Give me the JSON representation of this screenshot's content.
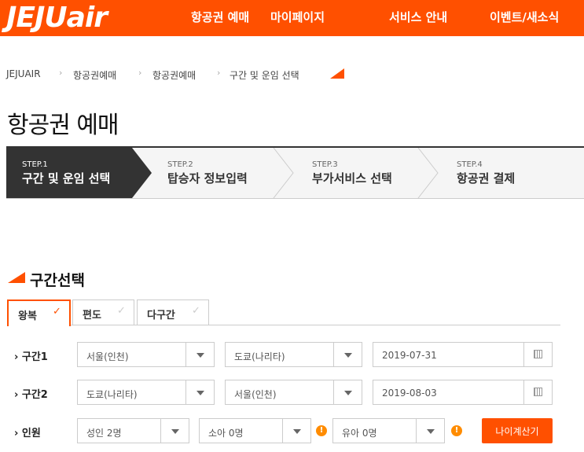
{
  "header": {
    "logo": "JEJUair",
    "nav": [
      "항공권 예매",
      "마이페이지",
      "서비스 안내",
      "이벤트/새소식"
    ]
  },
  "breadcrumb": [
    "JEJUAIR",
    "항공권예매",
    "항공권예매",
    "구간 및 운임 선택"
  ],
  "page_title": "항공권 예매",
  "steps": [
    {
      "num": "STEP.1",
      "label": "구간 및 운임 선택",
      "active": true
    },
    {
      "num": "STEP.2",
      "label": "탑승자 정보입력",
      "active": false
    },
    {
      "num": "STEP.3",
      "label": "부가서비스 선택",
      "active": false
    },
    {
      "num": "STEP.4",
      "label": "항공권 결제",
      "active": false
    }
  ],
  "section_title": "구간선택",
  "trip_tabs": [
    {
      "label": "왕복",
      "selected": true
    },
    {
      "label": "편도",
      "selected": false
    },
    {
      "label": "다구간",
      "selected": false
    }
  ],
  "segments": [
    {
      "label": "› 구간1",
      "from": "서울(인천)",
      "to": "도쿄(나리타)",
      "date": "2019-07-31"
    },
    {
      "label": "› 구간2",
      "from": "도쿄(나리타)",
      "to": "서울(인천)",
      "date": "2019-08-03"
    }
  ],
  "passengers": {
    "label": "› 인원",
    "adult": "성인 2명",
    "child": "소아 0명",
    "infant": "유아 0명",
    "age_button": "나이계산기"
  },
  "colors": {
    "brand": "#ff5000",
    "dark": "#333333",
    "info": "#ff8c00"
  }
}
